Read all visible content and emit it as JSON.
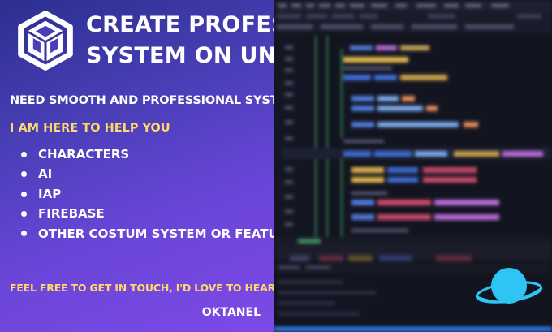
{
  "headline": {
    "line1": "CREATE PROFESIONAL",
    "line2": "SYSTEM ON UNITY"
  },
  "question": "NEED SMOOTH AND PROFESSIONAL SYSTEM ON UNITY?",
  "help": "I AM HERE TO HELP YOU",
  "services": [
    "CHARACTERS",
    "AI",
    "IAP",
    "FIREBASE",
    "OTHER COSTUM SYSTEM OR FEATURES"
  ],
  "contact": "FEEL FREE TO GET IN TOUCH, I'D LOVE TO HEAR FROM YOU.",
  "signature": "OKTANEL",
  "colors": {
    "headline": "#ffffff",
    "accent_yellow": "#ffd86b",
    "gradient_start": "#2b2f8f",
    "gradient_end": "#7d4ae6",
    "editor_bg": "#11131d",
    "orb": "#2ec5f5"
  },
  "icons": {
    "logo": "unity-logo-icon",
    "orb": "planet-orb-icon"
  }
}
